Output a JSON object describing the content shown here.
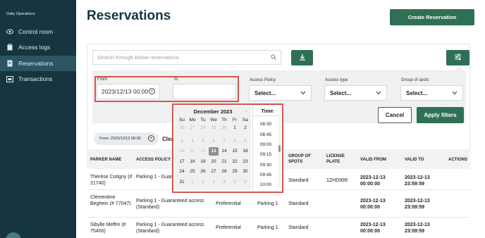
{
  "sidebar": {
    "brand": "Daily Operations",
    "items": [
      {
        "label": "Control room",
        "icon": "eye-icon"
      },
      {
        "label": "Access logs",
        "icon": "clipboard-icon"
      },
      {
        "label": "Reservations",
        "icon": "document-icon"
      },
      {
        "label": "Transactions",
        "icon": "receipt-icon"
      }
    ],
    "active_index": 2
  },
  "header": {
    "title": "Reservations",
    "create_label": "Create Reservation"
  },
  "search": {
    "placeholder": "Search through below reservations"
  },
  "filters": {
    "from_label": "From",
    "from_value": "2023/12/13 00:00",
    "to_label": "To",
    "to_value": "",
    "access_policy_label": "Access Policy",
    "access_policy_value": "Select...",
    "access_type_label": "Access type",
    "access_type_value": "Select...",
    "group_label": "Group of spots",
    "group_value": "Select...",
    "cancel_label": "Cancel",
    "apply_label": "Apply filters"
  },
  "calendar": {
    "month": "December 2023",
    "weekdays": [
      "Su",
      "Mo",
      "Tu",
      "We",
      "Th",
      "Fr",
      "Sa"
    ],
    "weeks": [
      [
        "26",
        "27",
        "28",
        "29",
        "30",
        "1",
        "2"
      ],
      [
        "3",
        "4",
        "5",
        "6",
        "7",
        "8",
        "9"
      ],
      [
        "10",
        "11",
        "12",
        "13",
        "14",
        "15",
        "16"
      ],
      [
        "17",
        "18",
        "19",
        "20",
        "21",
        "22",
        "23"
      ],
      [
        "24",
        "25",
        "26",
        "27",
        "28",
        "29",
        "30"
      ],
      [
        "31",
        "1",
        "2",
        "3",
        "4",
        "5",
        "6"
      ]
    ],
    "selected_day": "13",
    "time_label": "Time",
    "times": [
      "08:30",
      "08:45",
      "09:00",
      "09:15",
      "09:30",
      "09:45",
      "10:00"
    ]
  },
  "active_filter_chip": "From: 2023/12/13 00:00",
  "clear_label": "Clear",
  "table": {
    "headers": [
      "PARKER NAME",
      "ACCESS POLICY",
      "GROUP OF SPOTS",
      "LICENSE PLATE",
      "VALID FROM",
      "VALID TO",
      "ACTIONS"
    ],
    "rows": [
      {
        "name": "Thérèse Cotigny (# 21740)",
        "policy": "Parking 1 - Guarantee (Standard)",
        "group": "Standard",
        "plate": "1ZHD999",
        "from": "2023-12-13 00:00:00",
        "to": "2023-12-13 23:59:59"
      },
      {
        "name": "Clémentine Beghein (# 77047)",
        "policy": "Parking 1 - Guaranteed access (Standard)",
        "access_type": "Preferential",
        "parking": "Parking 1",
        "group": "Standard",
        "from": "2023-12-13 00:00:00",
        "to": "2023-12-13 23:59:59"
      },
      {
        "name": "Sibylle Meffre (# 75400)",
        "policy": "Parking 1 - Guaranteed access (Standard)",
        "access_type": "Preferential",
        "parking": "Parking 1",
        "group": "Standard",
        "from": "2023-12-13 00:00:00",
        "to": "2023-12-13 23:59:59"
      }
    ]
  },
  "colors": {
    "sidebar": "#173540",
    "sidebar_active": "#2b5563",
    "accent": "#2f7055",
    "highlight_border": "#d4554a"
  }
}
